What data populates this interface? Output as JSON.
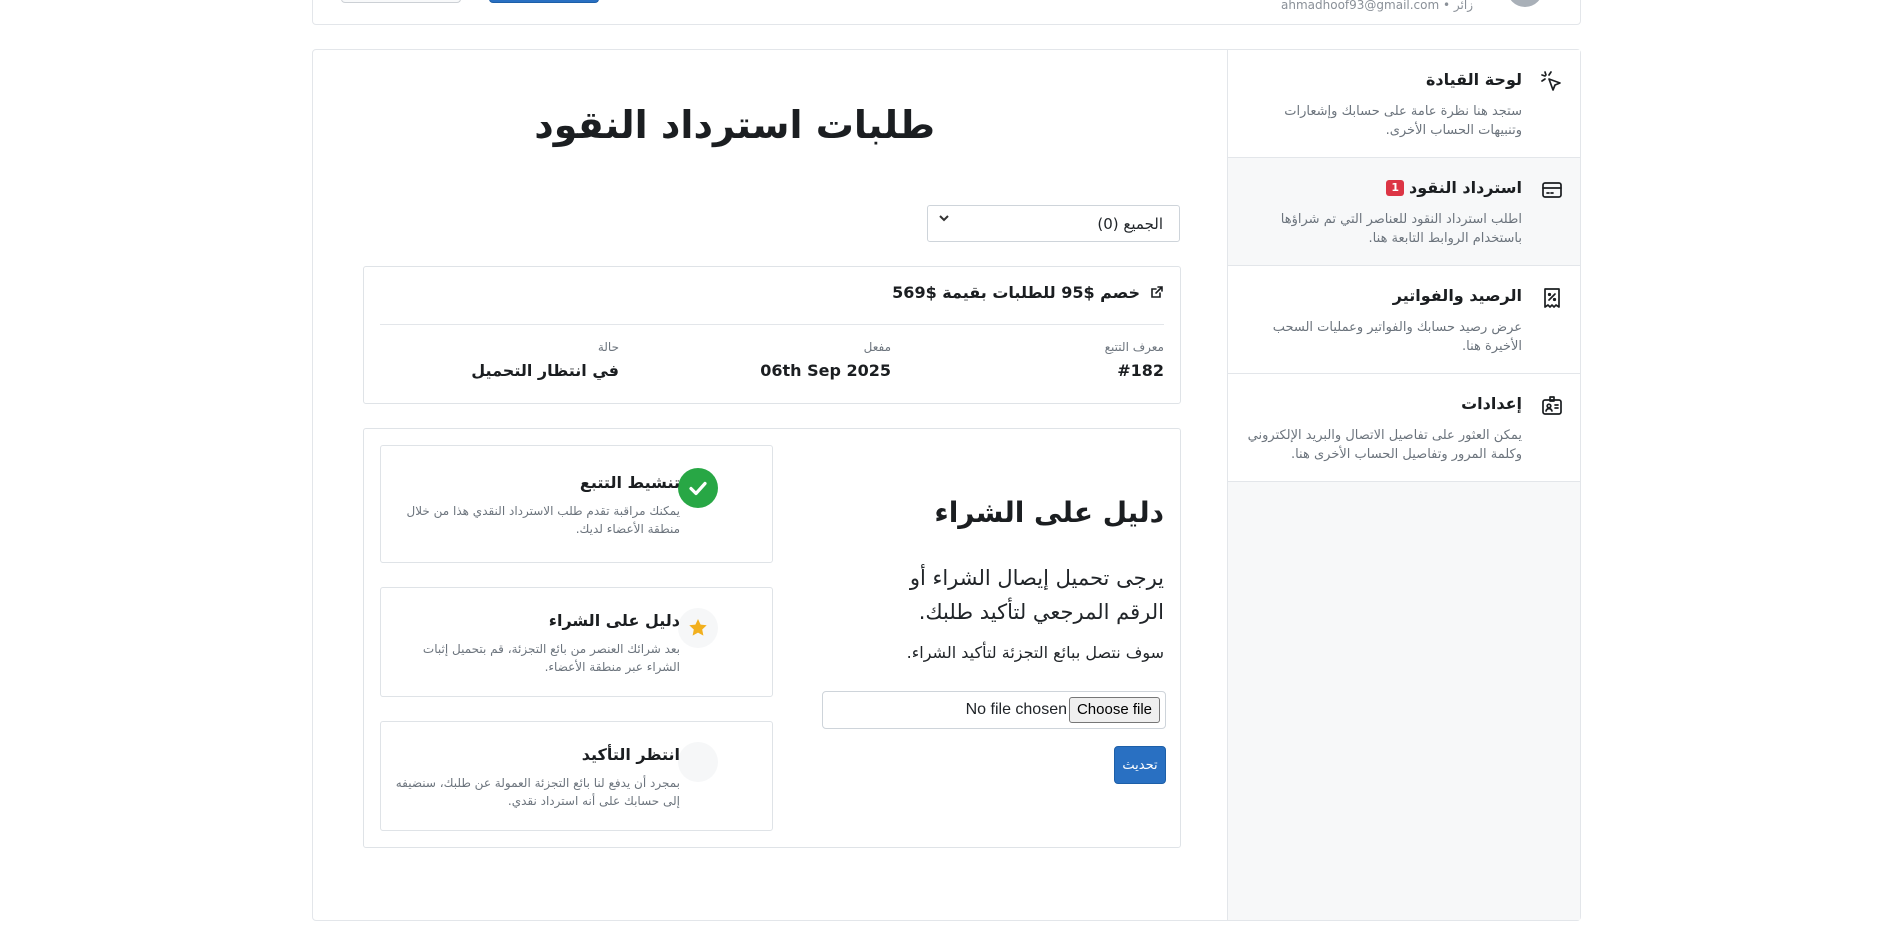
{
  "header": {
    "user_email": "ahmadhoof93@gmail.com",
    "user_prefix": "زائر •"
  },
  "sidebar": {
    "items": [
      {
        "title": "لوحة القيادة",
        "description": "ستجد هنا نظرة عامة على حسابك وإشعارات وتنبيهات الحساب الأخرى.",
        "icon": "cursor-click-icon"
      },
      {
        "title": "استرداد النقود",
        "badge": "1",
        "description": "اطلب استرداد النقود للعناصر التي تم شراؤها باستخدام الروابط التابعة هنا.",
        "icon": "credit-card-icon"
      },
      {
        "title": "الرصيد والفواتير",
        "description": "عرض رصيد حسابك والفواتير وعمليات السحب الأخيرة هنا.",
        "icon": "receipt-percent-icon"
      },
      {
        "title": "إعدادات",
        "description": "يمكن العثور على تفاصيل الاتصال والبريد الإلكتروني وكلمة المرور وتفاصيل الحساب الأخرى هنا.",
        "icon": "id-card-icon"
      }
    ]
  },
  "page": {
    "title": "طلبات استرداد النقود",
    "filter": {
      "selected": "الجميع (0)"
    }
  },
  "order": {
    "link_text": "خصم $95 للطلبات بقيمة $569",
    "tracking_label": "معرف التتبع",
    "tracking_value": "#182",
    "enabled_label": "مفعل",
    "enabled_value": "06th Sep 2025",
    "status_label": "حالة",
    "status_value": "في انتظار التحميل"
  },
  "proof": {
    "title": "دليل على الشراء",
    "instruction": "يرجى تحميل إيصال الشراء أو الرقم المرجعي لتأكيد طلبك.",
    "note": "سوف نتصل ببائع التجزئة لتأكيد الشراء.",
    "file_button": "Choose file",
    "file_status": "No file chosen",
    "submit_label": "تحديث"
  },
  "steps": [
    {
      "title": "تنشيط التتبع",
      "description": "يمكنك مراقبة تقدم طلب الاسترداد النقدي هذا من خلال منطقة الأعضاء لديك.",
      "state": "done"
    },
    {
      "title": "دليل على الشراء",
      "description": "بعد شرائك العنصر من بائع التجزئة، قم بتحميل إثبات الشراء عبر منطقة الأعضاء.",
      "state": "current"
    },
    {
      "title": "انتظر التأكيد",
      "description": "بمجرد أن يدفع لنا بائع التجزئة العمولة عن طلبك، سنضيفه إلى حسابك على أنه استرداد نقدي.",
      "state": "pending"
    }
  ],
  "colors": {
    "primary": "#2970c2",
    "success": "#28a745",
    "danger": "#dc3545",
    "star": "#f2b01e"
  }
}
